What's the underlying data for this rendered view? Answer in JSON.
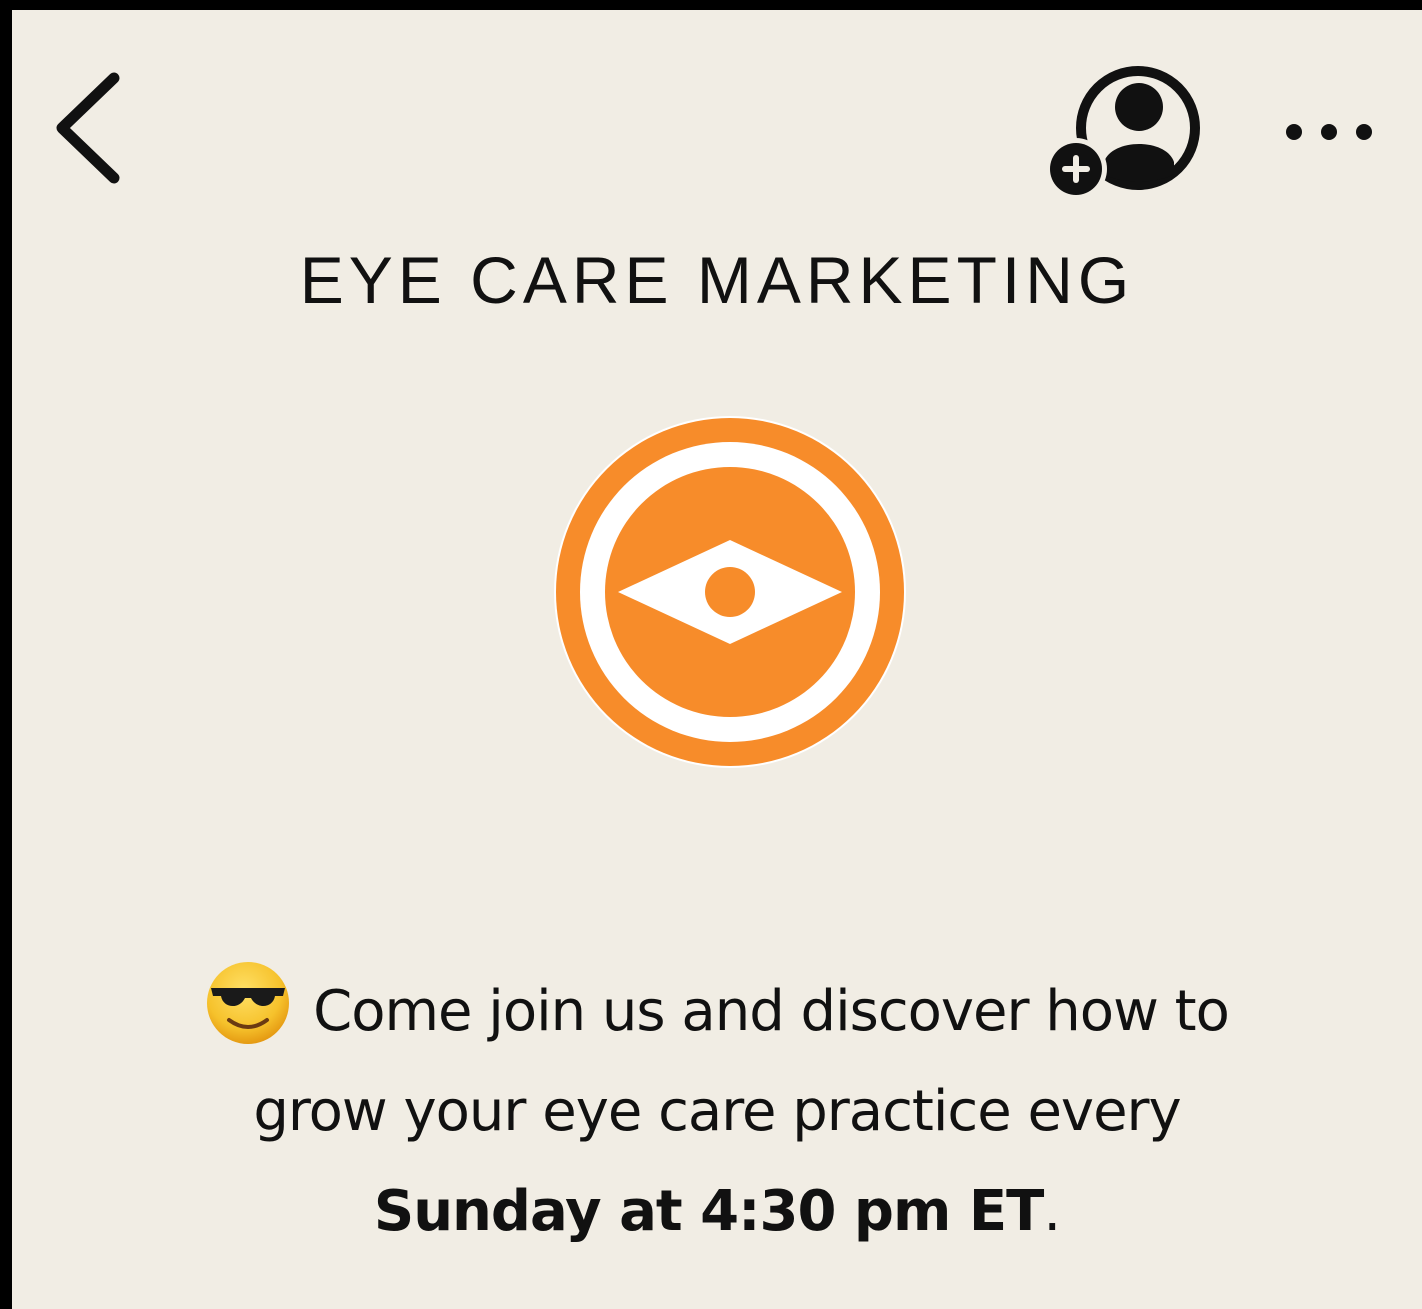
{
  "header": {
    "back_icon": "chevron-left-icon",
    "add_member_icon": "add-person-icon",
    "more_icon": "ellipsis-icon"
  },
  "club": {
    "title": "EYE CARE MARKETING",
    "logo_icon": "orange-eye-logo",
    "logo_colors": {
      "primary": "#f78c2a",
      "secondary": "#ffffff"
    },
    "description": {
      "emoji": "smiling-face-with-sunglasses-emoji",
      "line1": "Come join us and discover how to",
      "line2": "grow your eye care practice every",
      "schedule": "Sunday at 4:30 pm ET",
      "end_punct": "."
    }
  },
  "colors": {
    "background": "#f1ede4",
    "text": "#111111",
    "accent": "#f78c2a"
  }
}
